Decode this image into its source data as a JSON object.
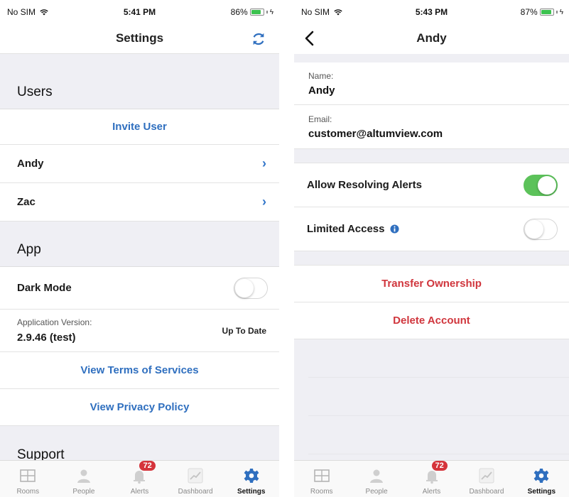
{
  "left": {
    "status": {
      "carrier": "No SIM",
      "time": "5:41 PM",
      "battery": "86%"
    },
    "title": "Settings",
    "users_header": "Users",
    "invite_label": "Invite User",
    "users": [
      {
        "name": "Andy"
      },
      {
        "name": "Zac"
      }
    ],
    "app_header": "App",
    "dark_mode_label": "Dark Mode",
    "dark_mode_on": false,
    "version_label": "Application Version:",
    "version_value": "2.9.46 (test)",
    "version_status": "Up To Date",
    "terms_label": "View Terms of Services",
    "privacy_label": "View Privacy Policy",
    "support_header": "Support"
  },
  "right": {
    "status": {
      "carrier": "No SIM",
      "time": "5:43 PM",
      "battery": "87%"
    },
    "title": "Andy",
    "name_label": "Name:",
    "name_value": "Andy",
    "email_label": "Email:",
    "email_value": "customer@altumview.com",
    "allow_resolving_label": "Allow Resolving Alerts",
    "allow_resolving_on": true,
    "limited_access_label": "Limited Access",
    "limited_access_on": false,
    "transfer_label": "Transfer Ownership",
    "delete_label": "Delete Account"
  },
  "tabs": [
    {
      "label": "Rooms",
      "icon": "rooms-icon"
    },
    {
      "label": "People",
      "icon": "people-icon"
    },
    {
      "label": "Alerts",
      "icon": "alerts-icon",
      "badge": "72"
    },
    {
      "label": "Dashboard",
      "icon": "dashboard-icon"
    },
    {
      "label": "Settings",
      "icon": "settings-icon",
      "active": true
    }
  ],
  "colors": {
    "accent": "#2f6fbf",
    "danger": "#d0363d",
    "toggle_on": "#5cc25a",
    "badge": "#d5343b"
  }
}
